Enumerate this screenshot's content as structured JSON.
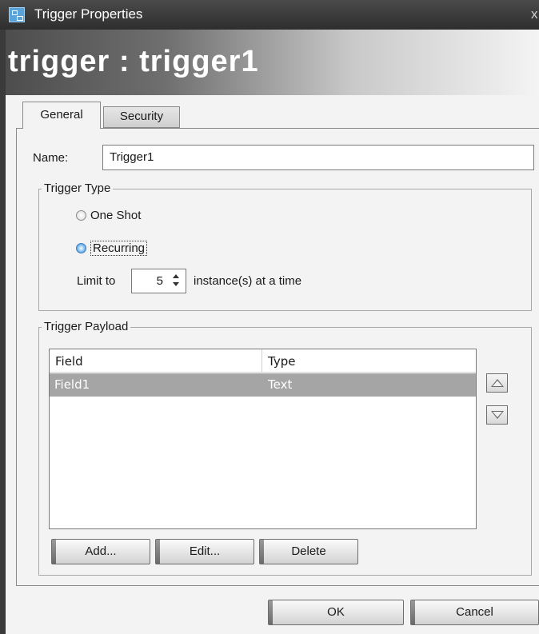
{
  "window": {
    "title": "Trigger Properties",
    "close_glyph": "x",
    "icon": "trigger-app-icon"
  },
  "banner": {
    "title": "trigger : trigger1"
  },
  "tabs": [
    {
      "label": "General",
      "selected": true
    },
    {
      "label": "Security",
      "selected": false
    }
  ],
  "general": {
    "name_label": "Name:",
    "name_value": "Trigger1",
    "trigger_type": {
      "title": "Trigger Type",
      "options": [
        {
          "label": "One Shot",
          "checked": false
        },
        {
          "label": "Recurring",
          "checked": true
        }
      ],
      "limit_prefix": "Limit to",
      "limit_value": "5",
      "limit_suffix": "instance(s) at a time"
    },
    "payload": {
      "title": "Trigger Payload",
      "columns": [
        "Field",
        "Type"
      ],
      "rows": [
        {
          "field": "Field1",
          "type": "Text",
          "selected": true
        }
      ],
      "buttons": {
        "add": "Add...",
        "edit": "Edit...",
        "delete": "Delete"
      }
    }
  },
  "footer": {
    "ok": "OK",
    "cancel": "Cancel"
  },
  "colors": {
    "titlebar": "#2e2e2e",
    "selected_row": "#a5a5a5",
    "radio_checked": "#3b7fc4"
  }
}
